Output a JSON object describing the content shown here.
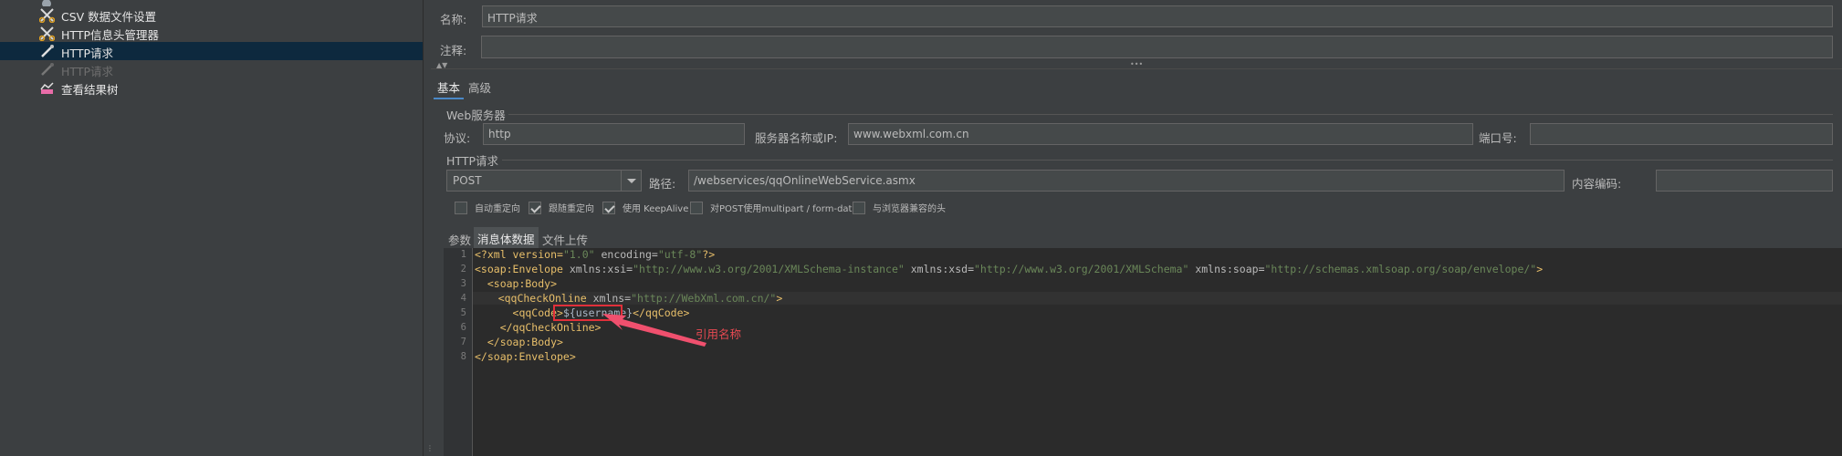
{
  "tree": {
    "items": [
      {
        "label": "CSV 数据文件设置",
        "icon": "scissors-icon"
      },
      {
        "label": "HTTP信息头管理器",
        "icon": "scissors-icon"
      },
      {
        "label": "HTTP请求",
        "icon": "pipette-icon"
      },
      {
        "label": "HTTP请求",
        "icon": "pipette-icon"
      },
      {
        "label": "查看结果树",
        "icon": "chart-icon"
      }
    ]
  },
  "form": {
    "name_label": "名称:",
    "name_value": "HTTP请求",
    "comment_label": "注释:",
    "comment_value": "",
    "collapse_arrows": "▲▼",
    "drag_dots": "•••"
  },
  "tabs_top": {
    "basic": "基本",
    "advanced": "高级"
  },
  "web_server": {
    "title": "Web服务器",
    "protocol_label": "协议:",
    "protocol_value": "http",
    "server_label": "服务器名称或IP:",
    "server_value": "www.webxml.com.cn",
    "port_label": "端口号:",
    "port_value": ""
  },
  "http_request": {
    "title": "HTTP请求",
    "method": "POST",
    "path_label": "路径:",
    "path_value": "/webservices/qqOnlineWebService.asmx",
    "encoding_label": "内容编码:",
    "encoding_value": ""
  },
  "checkboxes": [
    {
      "label": "自动重定向",
      "checked": false
    },
    {
      "label": "跟随重定向",
      "checked": true
    },
    {
      "label": "使用 KeepAlive",
      "checked": true
    },
    {
      "label": "对POST使用multipart / form-data",
      "checked": false
    },
    {
      "label": "与浏览器兼容的头",
      "checked": false
    }
  ],
  "body_tabs": {
    "params": "参数",
    "body": "消息体数据",
    "files": "文件上传"
  },
  "editor": {
    "line_numbers": [
      "1",
      "2",
      "3",
      "4",
      "5",
      "6",
      "7",
      "8"
    ],
    "lines": {
      "l1": {
        "a": "<?xml version=",
        "b": "\"1.0\"",
        "c": " encoding=",
        "d": "\"utf-8\"",
        "e": "?>"
      },
      "l2": {
        "a": "<soap:Envelope ",
        "b": "xmlns:xsi=",
        "c": "\"http://www.w3.org/2001/XMLSchema-instance\"",
        "d": " xmlns:xsd=",
        "e": "\"http://www.w3.org/2001/XMLSchema\"",
        "f": " xmlns:soap=",
        "g": "\"http://schemas.xmlsoap.org/soap/envelope/\"",
        "h": ">"
      },
      "l3": "  <soap:Body>",
      "l4": {
        "a": "    <qqCheckOnline ",
        "b": "xmlns=",
        "c": "\"http://WebXml.com.cn/\"",
        "d": ">"
      },
      "l5": {
        "a": "      <qqCode>",
        "b": "${username}",
        "c": "</qqCode>"
      },
      "l6": "    </qqCheckOnline>",
      "l7": "  </soap:Body>",
      "l8": "</soap:Envelope>"
    }
  },
  "annotation": {
    "text": "引用名称",
    "color": "#e0303a"
  }
}
